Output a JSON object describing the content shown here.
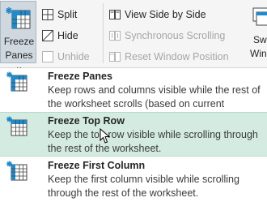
{
  "ribbon": {
    "freeze_panes": {
      "label_line1": "Freeze",
      "label_line2": "Panes",
      "chevron": "⌄",
      "icon": "freeze-panes-icon"
    },
    "split": {
      "label": "Split",
      "icon": "split-icon"
    },
    "hide": {
      "label": "Hide",
      "icon": "hide-icon"
    },
    "unhide": {
      "label": "Unhide",
      "icon": "unhide-icon"
    },
    "view_side_by_side": {
      "label": "View Side by Side",
      "icon": "side-by-side-icon"
    },
    "synchronous_scrolling": {
      "label": "Synchronous Scrolling",
      "icon": "sync-scroll-icon"
    },
    "reset_window_position": {
      "label": "Reset Window Position",
      "icon": "reset-window-icon"
    },
    "switch_windows": {
      "label_line1": "Sw",
      "label_line2": "Wind"
    }
  },
  "menu": {
    "items": [
      {
        "title": "Freeze Panes",
        "description": "Keep rows and columns visible while the rest of the worksheet scrolls (based on current selection)."
      },
      {
        "title": "Freeze Top Row",
        "description": "Keep the top row visible while scrolling through the rest of the worksheet."
      },
      {
        "title": "Freeze First Column",
        "description": "Keep the first column visible while scrolling through the rest of the worksheet."
      }
    ]
  },
  "colors": {
    "hover_bg": "#d3ebe0",
    "accent_blue": "#1e8bcd",
    "selected_button_bg": "#cfd8df"
  }
}
